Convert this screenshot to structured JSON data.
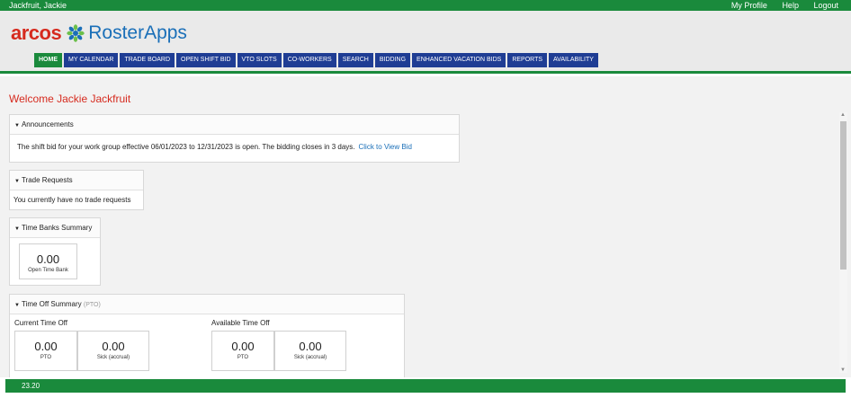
{
  "topbar": {
    "user_name": "Jackfruit, Jackie",
    "my_profile": "My Profile",
    "help": "Help",
    "logout": "Logout"
  },
  "logo": {
    "arcos": "arcos",
    "roster": "RosterApps"
  },
  "nav": {
    "tabs": [
      "HOME",
      "MY CALENDAR",
      "TRADE BOARD",
      "OPEN SHIFT BID",
      "VTO SLOTS",
      "CO-WORKERS",
      "SEARCH",
      "BIDDING",
      "ENHANCED VACATION BIDS",
      "REPORTS",
      "AVAILABILITY"
    ],
    "active": "HOME"
  },
  "welcome": "Welcome Jackie Jackfruit",
  "announcements": {
    "title": "Announcements",
    "message": "The shift bid for your work group effective 06/01/2023 to 12/31/2023 is open. The bidding closes in 3 days.",
    "link": "Click to View Bid"
  },
  "trade_requests": {
    "title": "Trade Requests",
    "message": "You currently have no trade requests"
  },
  "time_banks": {
    "title": "Time Banks Summary",
    "tiles": [
      {
        "value": "0.00",
        "label": "Open Time Bank"
      }
    ]
  },
  "time_off": {
    "title": "Time Off Summary",
    "subtitle": "(PTO)",
    "current_label": "Current Time Off",
    "available_label": "Available Time Off",
    "current_tiles": [
      {
        "value": "0.00",
        "label": "PTO"
      },
      {
        "value": "0.00",
        "label": "Sick (accrual)"
      }
    ],
    "available_tiles": [
      {
        "value": "0.00",
        "label": "PTO"
      },
      {
        "value": "0.00",
        "label": "Sick (accrual)"
      }
    ]
  },
  "footer": {
    "version": "23.20"
  },
  "colors": {
    "brand_green": "#1a8a3c",
    "nav_blue": "#1f3d94",
    "arcos_red": "#d62a1e",
    "link_blue": "#1a6fb8"
  }
}
